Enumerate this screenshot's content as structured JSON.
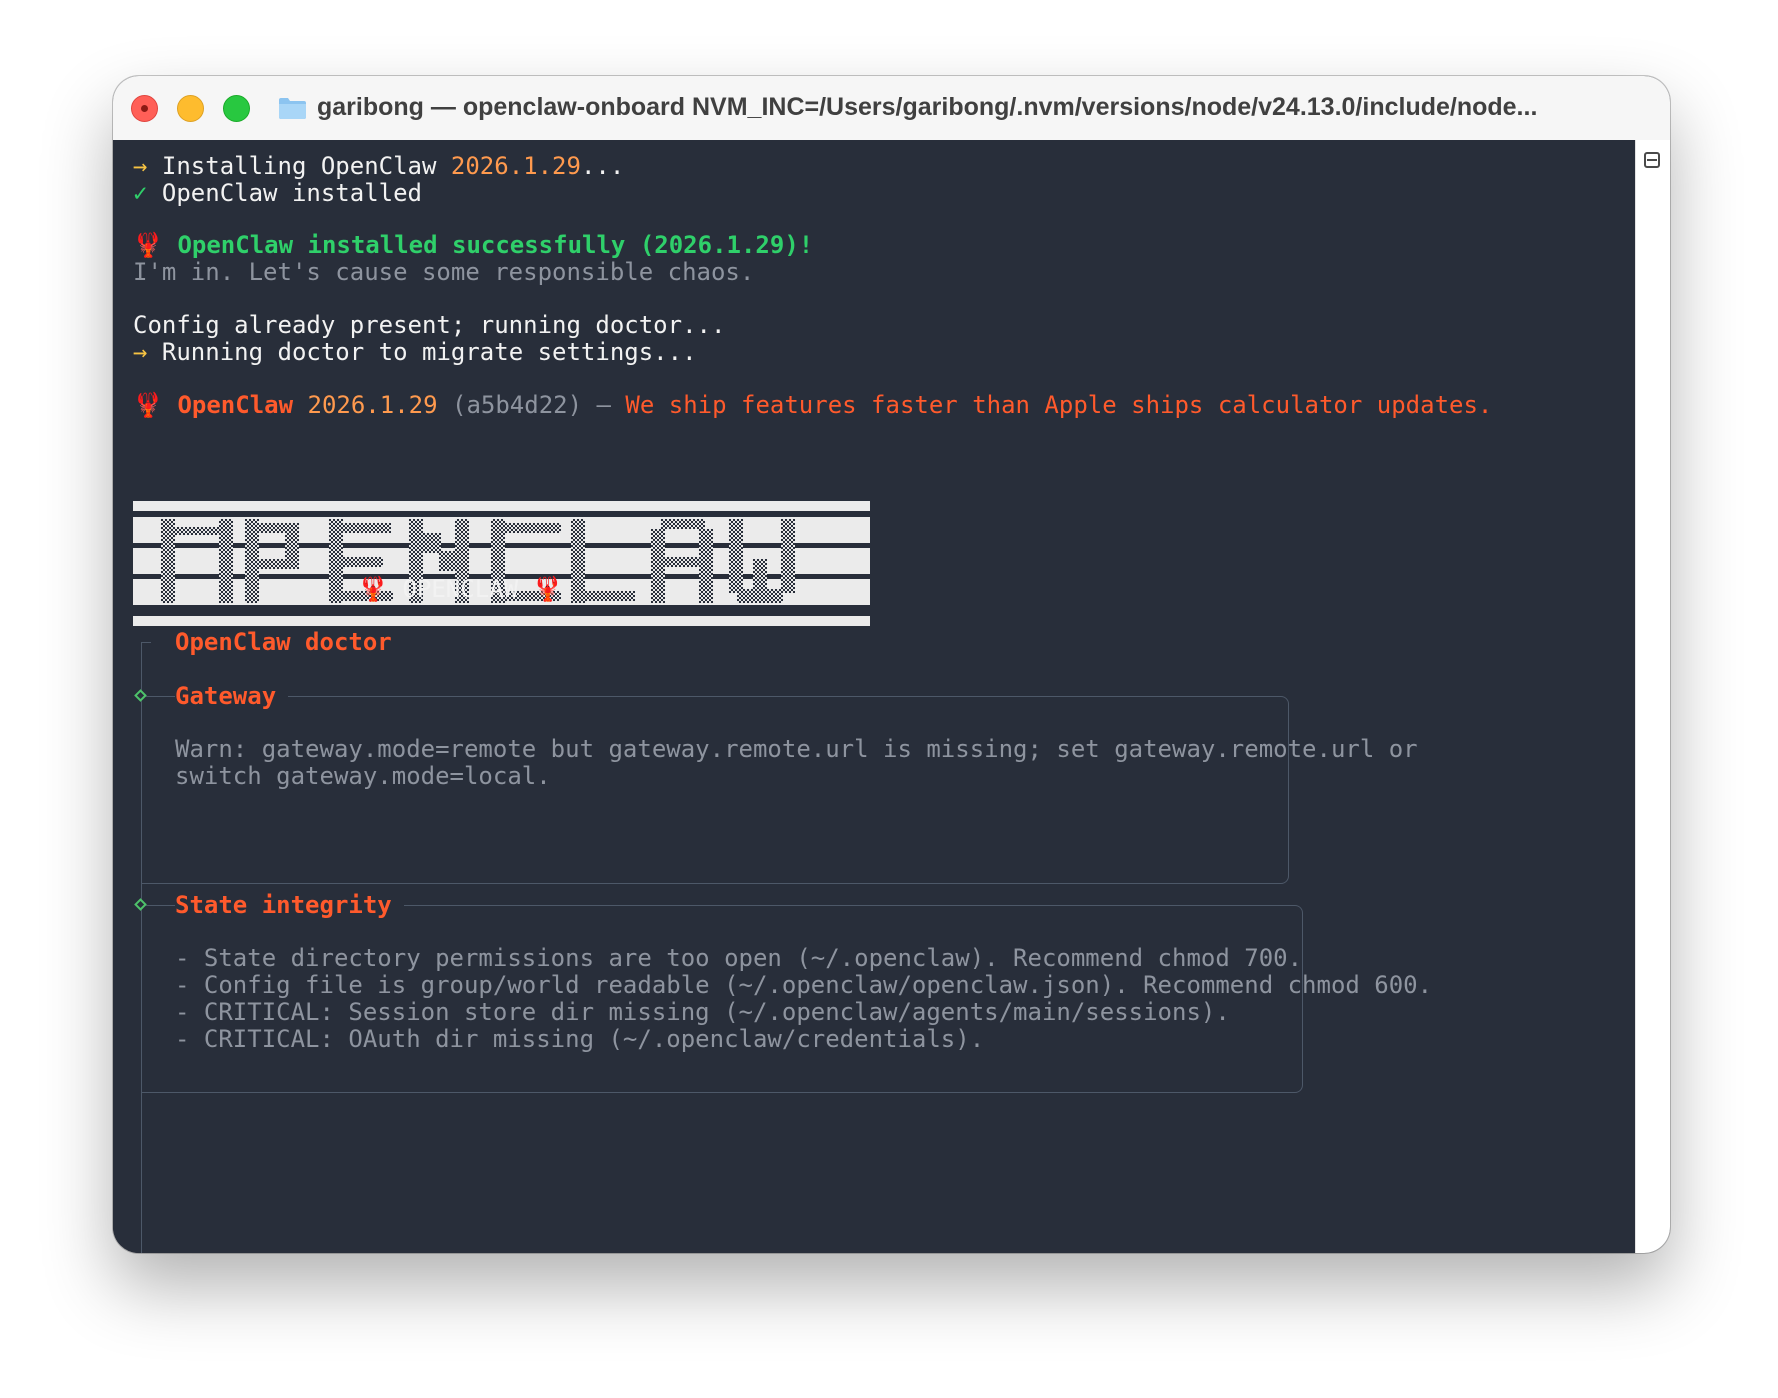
{
  "window": {
    "title": "garibong — openclaw-onboard NVM_INC=/Users/garibong/.nvm/versions/node/v24.13.0/include/node..."
  },
  "terminal": {
    "install_arrow": "→",
    "installing_prefix": "Installing OpenClaw ",
    "installing_version": "2026.1.29",
    "installing_suffix": "...",
    "installed_check": "✓",
    "installed_text": "OpenClaw installed",
    "lobster_emoji": "🦞",
    "success_text": "OpenClaw installed successfully (2026.1.29)!",
    "tagline": "I'm in. Let's cause some responsible chaos.",
    "config_text": "Config already present; running doctor...",
    "doctor_arrow": "→",
    "doctor_text": "Running doctor to migrate settings...",
    "brand_name": "OpenClaw",
    "brand_version": "2026.1.29",
    "brand_commit": "(a5b4d22)",
    "brand_dash": "—",
    "brand_slogan": "We ship features faster than Apple ships calculator updates.",
    "banner_caption": "OPENCLAW",
    "doctor_title": "OpenClaw doctor",
    "sections": [
      {
        "title": "Gateway",
        "lines": [
          "Warn: gateway.mode=remote but gateway.remote.url is missing; set gateway.remote.url or",
          "switch gateway.mode=local."
        ]
      },
      {
        "title": "State integrity",
        "lines": [
          "- State directory permissions are too open (~/.openclaw). Recommend chmod 700.",
          "- Config file is group/world readable (~/.openclaw/openclaw.json). Recommend chmod 600.",
          "- CRITICAL: Session store dir missing (~/.openclaw/agents/main/sessions).",
          "- CRITICAL: OAuth dir missing (~/.openclaw/credentials)."
        ]
      }
    ]
  },
  "colors": {
    "terminal_bg": "#282e3a",
    "accent_orange": "#ff5a2c",
    "success_green": "#2fd06a",
    "arrow_yellow": "#f6c343",
    "version_orange": "#ff9a4e",
    "dim_gray": "#8e949f"
  },
  "icons": {
    "folder": "folder-icon",
    "lobster": "lobster-emoji",
    "diamond": "diamond-bullet-icon",
    "scroll": "scroll-toggle-icon"
  }
}
